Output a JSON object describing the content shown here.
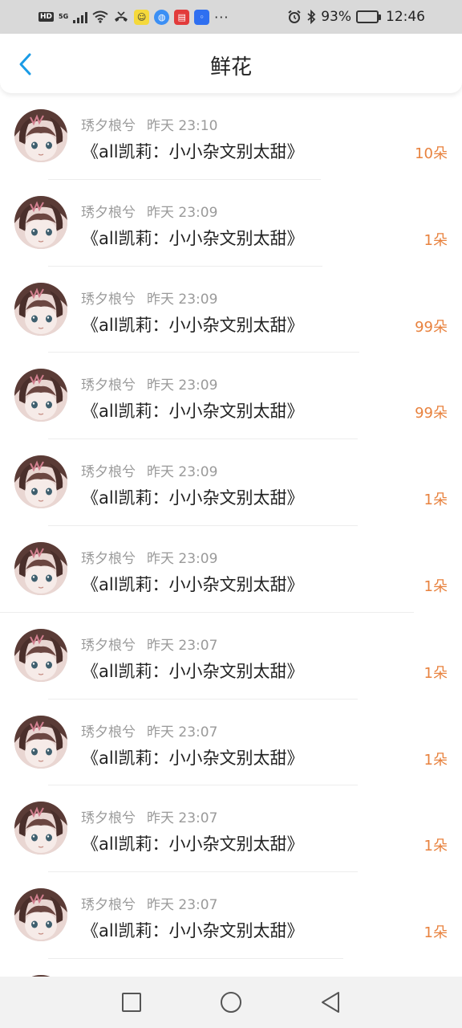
{
  "status_bar": {
    "hd": "HD",
    "network": "5G",
    "icons": [
      "hd-icon",
      "signal-icon",
      "wifi-icon",
      "missed-call-icon",
      "app-notif-icon",
      "browser-icon",
      "reader-app-icon",
      "bulb-app-icon",
      "more-dots-icon",
      "alarm-icon",
      "bluetooth-icon",
      "battery-icon"
    ],
    "more": "···",
    "battery": "93%",
    "battery_level": 0.93,
    "time": "12:46"
  },
  "header": {
    "title": "鲜花",
    "back_icon": "chevron-left-icon",
    "accent": "#1a9be6"
  },
  "colors": {
    "flower_count": "#e8823e",
    "meta": "#9a9a9a",
    "title": "#222222"
  },
  "records": [
    {
      "user": "琇夕桹兮",
      "time": "昨天 23:10",
      "work": "《all凯莉：小小杂文别太甜》",
      "count": "10朵"
    },
    {
      "user": "琇夕桹兮",
      "time": "昨天 23:09",
      "work": "《all凯莉：小小杂文别太甜》",
      "count": "1朵"
    },
    {
      "user": "琇夕桹兮",
      "time": "昨天 23:09",
      "work": "《all凯莉：小小杂文别太甜》",
      "count": "99朵"
    },
    {
      "user": "琇夕桹兮",
      "time": "昨天 23:09",
      "work": "《all凯莉：小小杂文别太甜》",
      "count": "99朵"
    },
    {
      "user": "琇夕桹兮",
      "time": "昨天 23:09",
      "work": "《all凯莉：小小杂文别太甜》",
      "count": "1朵"
    },
    {
      "user": "琇夕桹兮",
      "time": "昨天 23:09",
      "work": "《all凯莉：小小杂文别太甜》",
      "count": "1朵"
    },
    {
      "user": "琇夕桹兮",
      "time": "昨天 23:07",
      "work": "《all凯莉：小小杂文别太甜》",
      "count": "1朵"
    },
    {
      "user": "琇夕桹兮",
      "time": "昨天 23:07",
      "work": "《all凯莉：小小杂文别太甜》",
      "count": "1朵"
    },
    {
      "user": "琇夕桹兮",
      "time": "昨天 23:07",
      "work": "《all凯莉：小小杂文别太甜》",
      "count": "1朵"
    },
    {
      "user": "琇夕桹兮",
      "time": "昨天 23:07",
      "work": "《all凯莉：小小杂文别太甜》",
      "count": "1朵"
    }
  ],
  "nav": {
    "icons": [
      "square-recents-icon",
      "circle-home-icon",
      "triangle-back-icon"
    ]
  }
}
